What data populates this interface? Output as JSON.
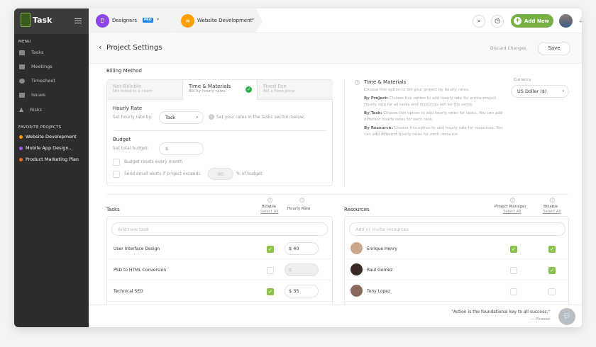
{
  "app": {
    "logo_text": "Task"
  },
  "sidebar": {
    "menu_label": "MENU",
    "items": [
      {
        "label": "Tasks",
        "icon": "tasks-icon"
      },
      {
        "label": "Meetings",
        "icon": "calendar-icon"
      },
      {
        "label": "Timesheet",
        "icon": "stopwatch-icon"
      },
      {
        "label": "Issues",
        "icon": "issues-icon"
      },
      {
        "label": "Risks",
        "icon": "warning-icon"
      }
    ],
    "favorites_label": "FAVORITE PROJECTS",
    "favorites": [
      {
        "label": "Website Development",
        "color": "#ff9800"
      },
      {
        "label": "Mobile App Design...",
        "color": "#a05cf0"
      },
      {
        "label": "Product Marketing Plan",
        "color": "#ff6a1a"
      }
    ]
  },
  "topbar": {
    "workspace": "Designers",
    "workspace_initial": "D",
    "badge": "PRO",
    "project": "Website Development",
    "add_new": "Add New"
  },
  "header": {
    "title": "Project Settings",
    "discard": "Discard Changes",
    "save": "Save"
  },
  "billing": {
    "label": "Billing Method",
    "tabs": [
      {
        "title": "Not-Billable",
        "sub": "Not billed to a client"
      },
      {
        "title": "Time & Materials",
        "sub": "Bill by hourly rates"
      },
      {
        "title": "Fixed Fee",
        "sub": "Bill a fixed price"
      }
    ],
    "hourly_title": "Hourly Rate",
    "hourly_label": "Set hourly rate by:",
    "hourly_value": "Task",
    "hourly_note": "Set your rates in the Tasks section below.",
    "budget_title": "Budget",
    "budget_label": "Set total budget:",
    "budget_prefix": "$",
    "resets": "Budget resets every month",
    "alerts": "Send email alerts if project exceeds",
    "alert_value": "80",
    "alert_suffix": "% of budget"
  },
  "info": {
    "title": "Time & Materials",
    "desc": "Choose this option to bill your project by hourly rates.",
    "p1_b": "By Project:",
    "p1": " Choose this option to add hourly rate for entire project. Hourly rate for all tasks and resources will be the same.",
    "p2_b": "By Task:",
    "p2": " Choose this option to add hourly rates for tasks. You can add different hourly rates for each task.",
    "p3_b": "By Resource:",
    "p3": " Choose this option to add hourly rate for resources. You can add different hourly rates for each resource.",
    "currency_label": "Currency",
    "currency": "US Dollar ($)"
  },
  "tasks": {
    "title": "Tasks",
    "billable": "Billable",
    "select_all": "Select All",
    "hourly": "Hourly Rate",
    "placeholder": "Add new task",
    "rows": [
      {
        "name": "User Interface Design",
        "billable": true,
        "rate": "$ 40"
      },
      {
        "name": "PSD to HTML Conversion",
        "billable": false,
        "rate": "$"
      },
      {
        "name": "Technical SEO",
        "billable": true,
        "rate": "$ 35"
      }
    ]
  },
  "resources": {
    "title": "Resources",
    "pm": "Project Manager",
    "billable": "Billable",
    "select_all": "Select All",
    "placeholder": "Add or invite resources",
    "rows": [
      {
        "name": "Enrique Henry",
        "pm": true,
        "billable": true
      },
      {
        "name": "Raul Gomez",
        "pm": false,
        "billable": true
      },
      {
        "name": "Tony Lopez",
        "pm": false,
        "billable": false
      }
    ]
  },
  "footer": {
    "quote": "\"Action is the foundational key to all success.\"",
    "author": "— Picasso"
  }
}
